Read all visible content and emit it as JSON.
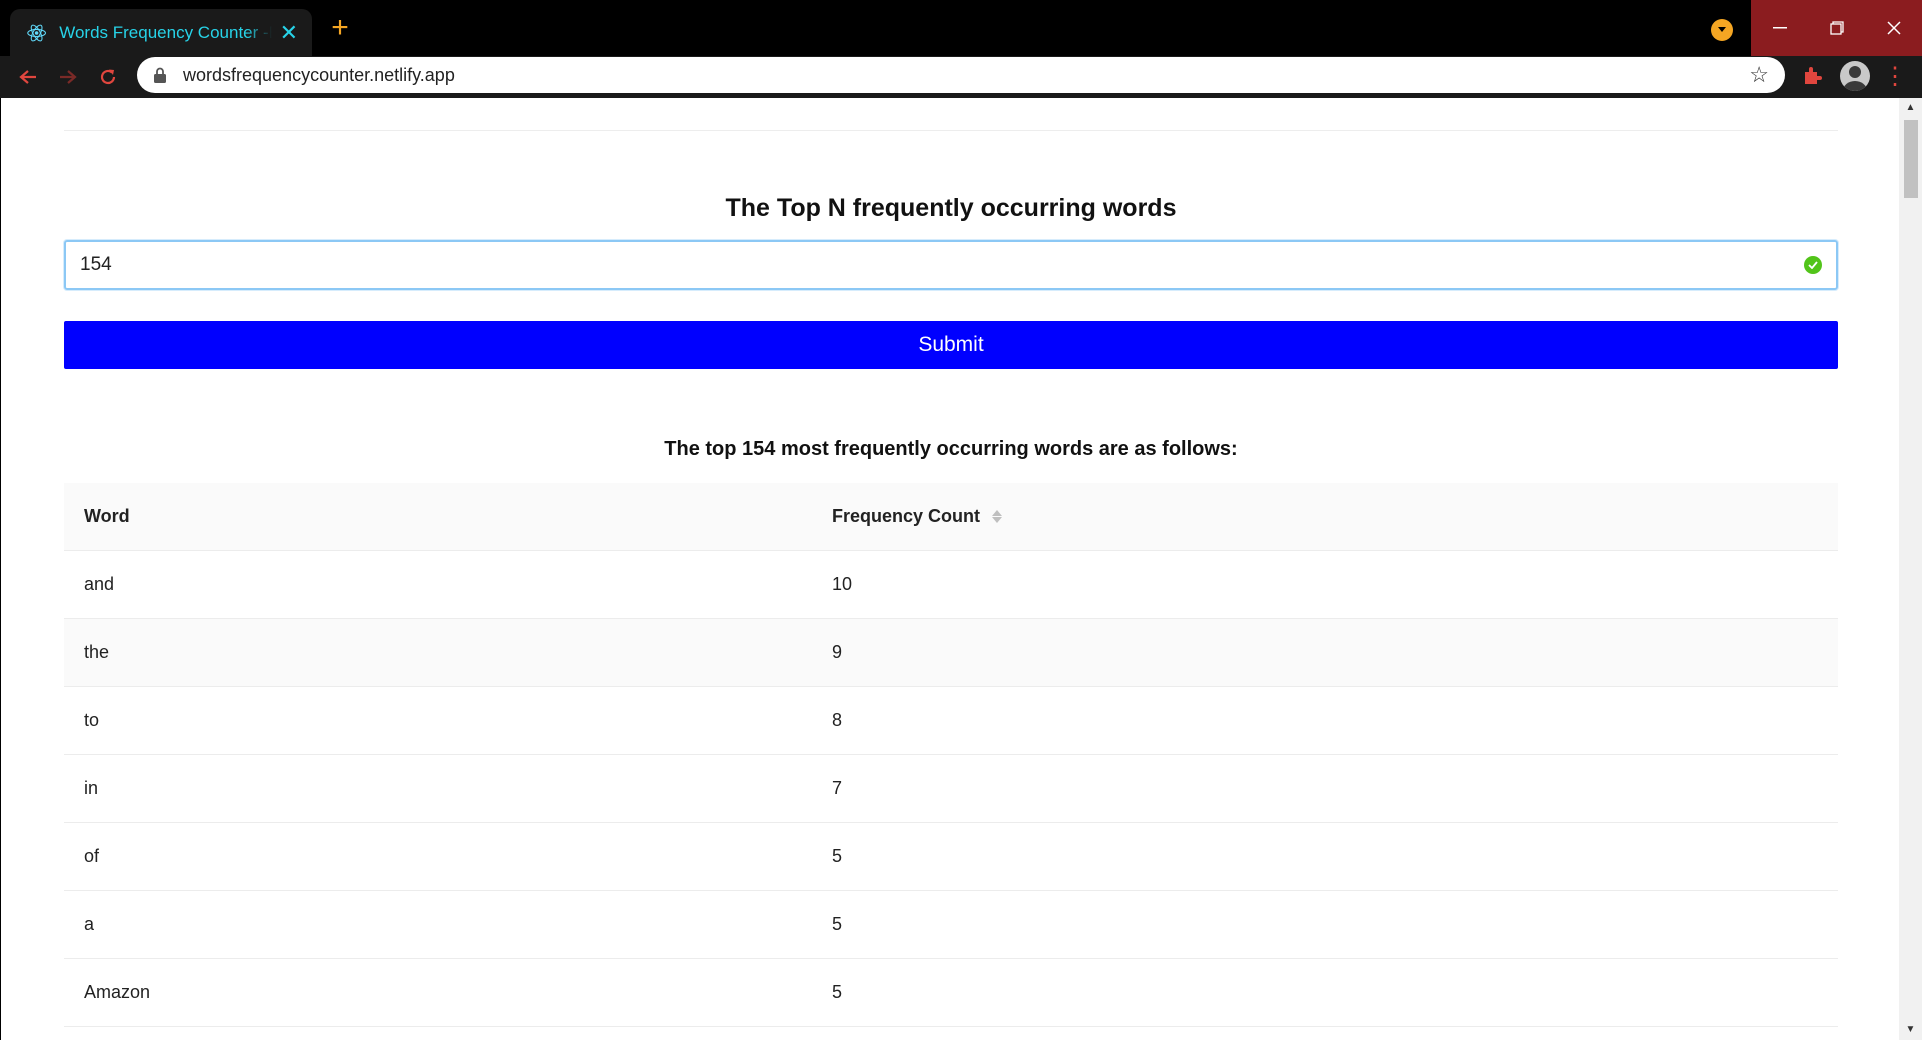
{
  "browser": {
    "tab_title": "Words Frequency Counter -Badal",
    "url": "wordsfrequencycounter.netlify.app",
    "tab_accent": "#27d3e8",
    "nav_accent": "#e0463e",
    "new_tab_color": "#f5a623"
  },
  "page": {
    "heading": "The Top N frequently occurring words",
    "input_value": "154",
    "submit_label": "Submit",
    "submit_color": "#0000ff",
    "result_heading": "The top 154 most frequently occurring words are as follows:"
  },
  "table": {
    "columns": [
      "Word",
      "Frequency Count"
    ],
    "rows": [
      {
        "word": "and",
        "count": "10"
      },
      {
        "word": "the",
        "count": "9"
      },
      {
        "word": "to",
        "count": "8"
      },
      {
        "word": "in",
        "count": "7"
      },
      {
        "word": "of",
        "count": "5"
      },
      {
        "word": "a",
        "count": "5"
      },
      {
        "word": "Amazon",
        "count": "5"
      }
    ]
  }
}
